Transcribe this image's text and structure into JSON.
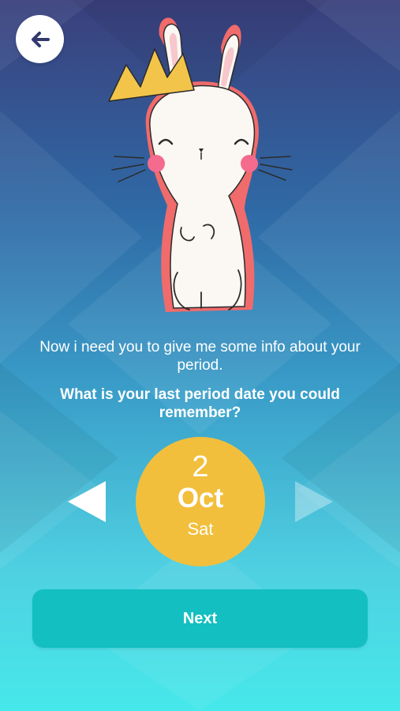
{
  "header": {
    "back_icon": "arrow-left-icon"
  },
  "illustration": {
    "subject": "bunny-with-crown"
  },
  "intro_text": "Now i need you to give me some info about your period.",
  "question_text": "What is your last period date you could remember?",
  "date_picker": {
    "day": "2",
    "month": "Oct",
    "weekday": "Sat",
    "prev_icon": "triangle-left-icon",
    "next_icon": "triangle-right-icon"
  },
  "next_button": {
    "label": "Next"
  },
  "colors": {
    "accent_yellow": "#f2bf3c",
    "button_teal": "#13bfc0",
    "back_arrow": "#33386f"
  }
}
